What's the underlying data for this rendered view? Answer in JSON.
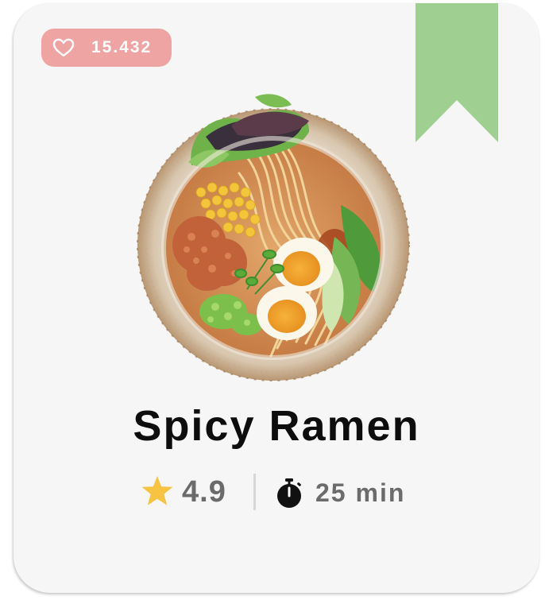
{
  "card": {
    "background": "#f6f6f6"
  },
  "likes": {
    "count": "15.432",
    "icon": "heart-outline-icon",
    "badge_color": "#eea4a3",
    "text_color": "#ffffff"
  },
  "bookmark": {
    "icon": "bookmark-ribbon-icon",
    "color": "#a0cf92"
  },
  "recipe": {
    "image": "ramen-bowl-photo",
    "title": "Spicy Ramen",
    "rating": "4.9",
    "rating_icon": "star-icon",
    "rating_icon_color": "#f6c343",
    "time": "25 min",
    "time_icon": "stopwatch-icon"
  }
}
